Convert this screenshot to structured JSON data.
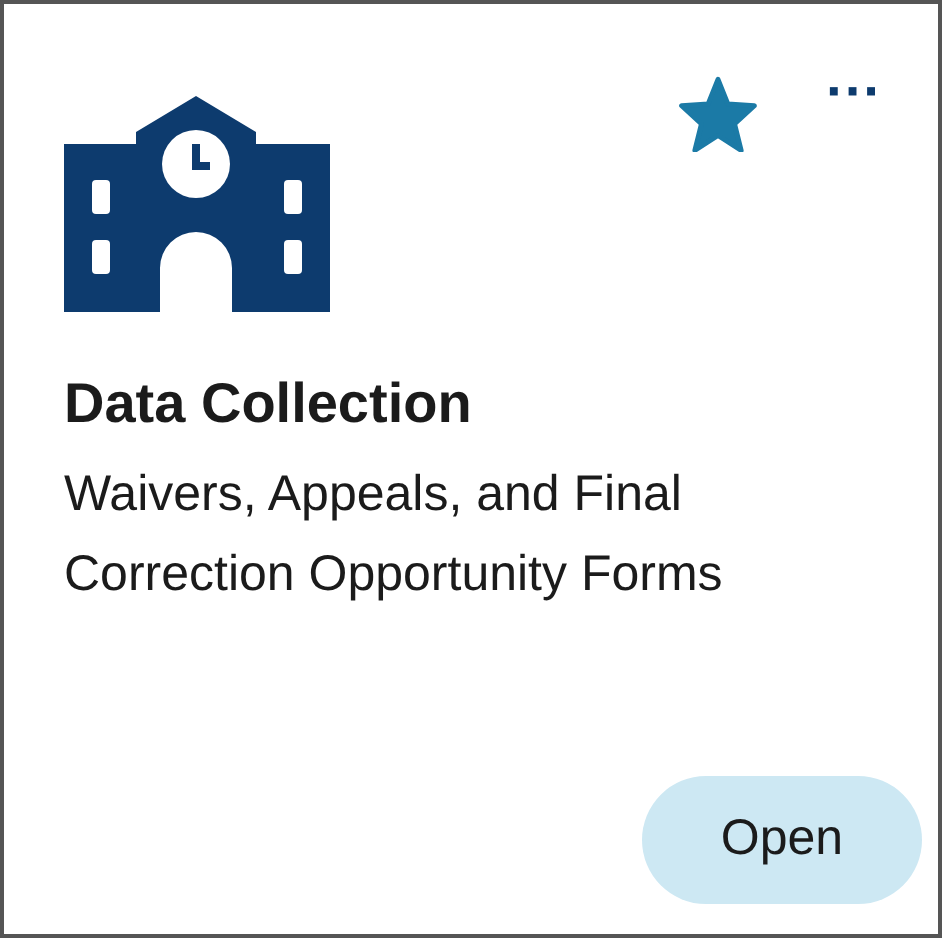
{
  "card": {
    "title": "Data Collection",
    "description": "Waivers, Appeals, and Final Correction Opportunity Forms",
    "starred": true,
    "more": "···",
    "button": "Open"
  }
}
